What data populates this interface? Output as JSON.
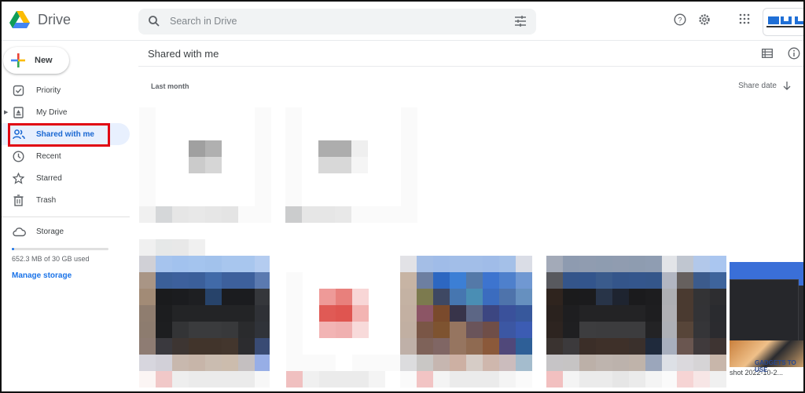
{
  "app": {
    "name": "Drive",
    "search_placeholder": "Search in Drive"
  },
  "header_icons": [
    "help-icon",
    "settings-icon",
    "apps-grid-icon",
    "account-avatar"
  ],
  "sidebar": {
    "new_label": "New",
    "items": [
      {
        "label": "Priority",
        "icon": "priority-icon",
        "active": false
      },
      {
        "label": "My Drive",
        "icon": "my-drive-icon",
        "active": false,
        "expandable": true
      },
      {
        "label": "Shared with me",
        "icon": "shared-icon",
        "active": true
      },
      {
        "label": "Recent",
        "icon": "clock-icon",
        "active": false
      },
      {
        "label": "Starred",
        "icon": "star-icon",
        "active": false
      },
      {
        "label": "Trash",
        "icon": "trash-icon",
        "active": false
      }
    ],
    "storage": {
      "label": "Storage",
      "usage_text": "652.3 MB of 30 GB used",
      "used_fraction": 0.021,
      "manage_label": "Manage storage"
    }
  },
  "main": {
    "title": "Shared with me",
    "section_label": "Last month",
    "sort_label": "Share date",
    "files": [
      {
        "name": "(blurred)",
        "type": "document"
      },
      {
        "name": "(blurred)",
        "type": "document"
      },
      {
        "name": "(blurred)",
        "type": "image"
      },
      {
        "name": "(blurred)",
        "type": "pdf"
      },
      {
        "name": "(blurred)",
        "type": "image"
      },
      {
        "name": "(blurred)",
        "type": "image"
      },
      {
        "name": "(blurred)",
        "type": "image"
      },
      {
        "name": "shot 2022-10-2...",
        "type": "image"
      }
    ],
    "watermark": "GADGETS TO USE"
  },
  "colors": {
    "accent": "#1a73e8",
    "active_bg": "#e8f0fe",
    "highlight_box": "#e10613"
  }
}
